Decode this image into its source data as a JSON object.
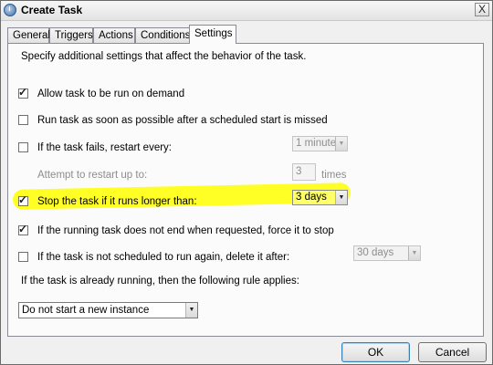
{
  "window": {
    "title": "Create Task",
    "close_glyph": "X",
    "icon": "task-scheduler-icon"
  },
  "tabs": [
    {
      "label": "General"
    },
    {
      "label": "Triggers"
    },
    {
      "label": "Actions"
    },
    {
      "label": "Conditions"
    },
    {
      "label": "Settings",
      "selected": true
    }
  ],
  "settings": {
    "description": "Specify additional settings that affect the behavior of the task.",
    "allow_on_demand": {
      "label": "Allow task to be run on demand",
      "checked": true
    },
    "run_asap": {
      "label": "Run task as soon as possible after a scheduled start is missed",
      "checked": false
    },
    "restart_on_fail": {
      "label": "If the task fails, restart every:",
      "checked": false,
      "interval": "1 minute"
    },
    "restart_attempts": {
      "label": "Attempt to restart up to:",
      "value": "3",
      "unit": "times"
    },
    "stop_if_long": {
      "label": "Stop the task if it runs longer than:",
      "checked": true,
      "duration": "3 days"
    },
    "force_stop": {
      "label": "If the running task does not end when requested, force it to stop",
      "checked": true
    },
    "delete_if_unscheduled": {
      "label": "If the task is not scheduled to run again, delete it after:",
      "checked": false,
      "duration": "30 days"
    },
    "running_rule_label": "If the task is already running, then the following rule applies:",
    "running_rule_value": "Do not start a new instance"
  },
  "buttons": {
    "ok": "OK",
    "cancel": "Cancel"
  },
  "colors": {
    "highlight": "#ffff00",
    "dialog_bg": "#f0f0f0"
  }
}
